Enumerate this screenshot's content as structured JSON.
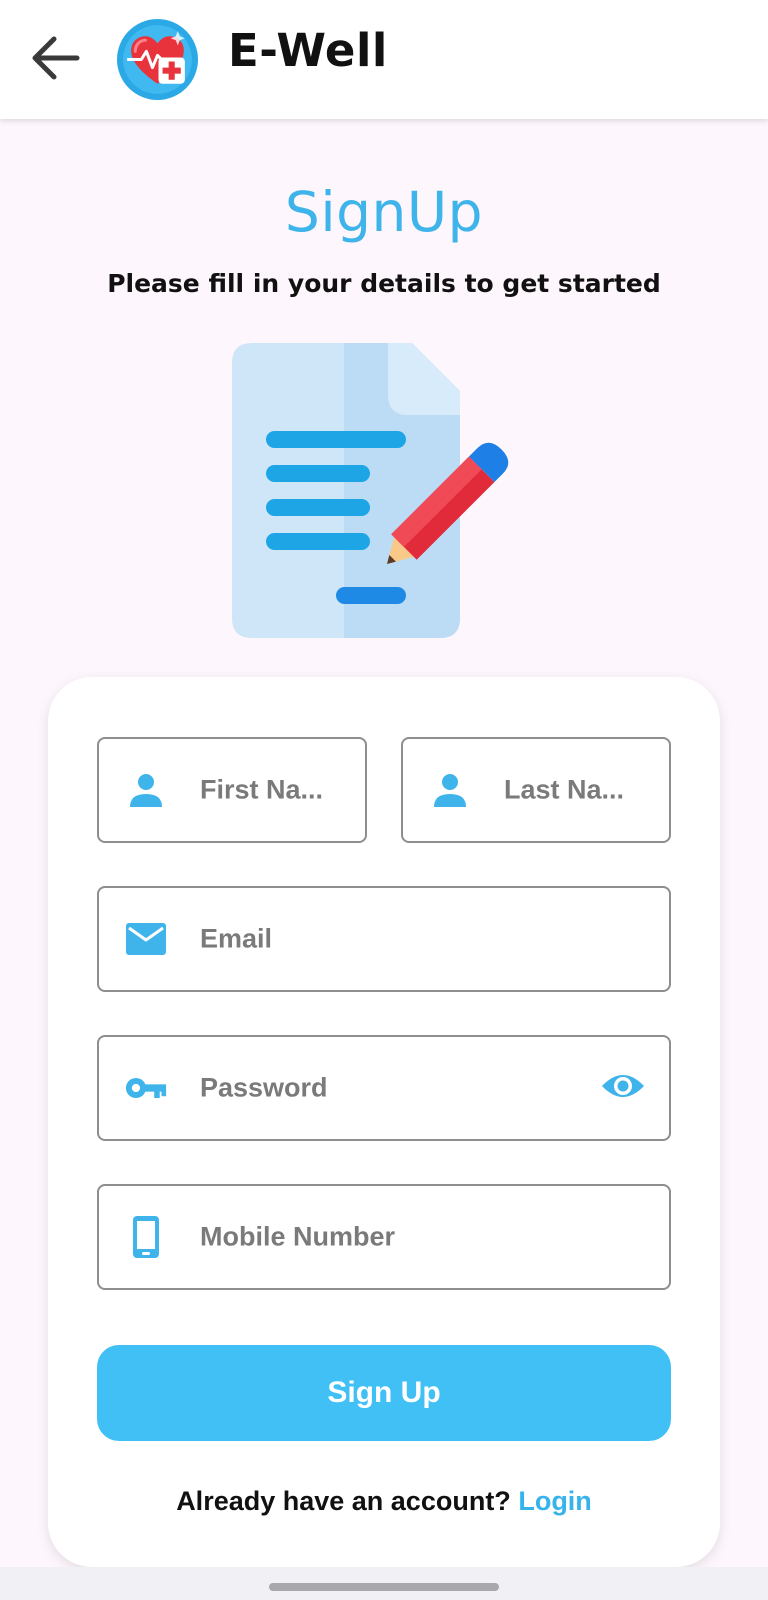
{
  "app_bar": {
    "title": "E-Well",
    "back_icon": "arrow-left-icon",
    "logo_icon": "heart-medical-cross-logo"
  },
  "header": {
    "title": "SignUp",
    "subtitle": "Please fill in your details to get started",
    "illustration": "document-with-pencil-illustration"
  },
  "form": {
    "first_name": {
      "placeholder": "First Na...",
      "icon": "person-icon"
    },
    "last_name": {
      "placeholder": "Last Na...",
      "icon": "person-icon"
    },
    "email": {
      "placeholder": "Email",
      "icon": "envelope-icon"
    },
    "password": {
      "placeholder": "Password",
      "icon": "key-icon",
      "toggle_icon": "eye-icon"
    },
    "mobile": {
      "placeholder": "Mobile Number",
      "icon": "smartphone-icon"
    },
    "submit_label": "Sign Up"
  },
  "footer": {
    "prompt": "Already have an account?",
    "login_label": "Login"
  },
  "colors": {
    "accent": "#40c0f5",
    "heading": "#3fb4ea",
    "background": "#fdf6fc",
    "field_border": "#8e8e8e",
    "placeholder": "#7a7a7a"
  }
}
